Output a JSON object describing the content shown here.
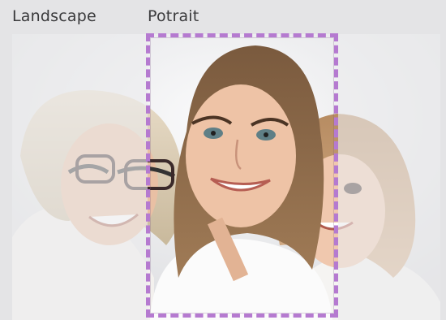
{
  "tabs": {
    "landscape_label": "Landscape",
    "portrait_label": "Potrait"
  },
  "colors": {
    "background": "#e4e4e6",
    "crop_border": "#b57ad0",
    "tab_text": "#3a3a3c"
  },
  "image": {
    "icon": "photo-of-three-generations"
  }
}
